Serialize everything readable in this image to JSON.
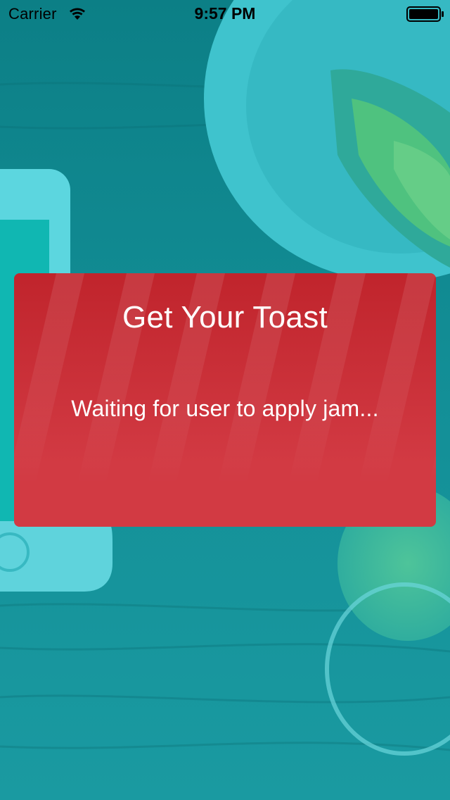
{
  "status_bar": {
    "carrier": "Carrier",
    "time": "9:57 PM",
    "wifi_icon": "wifi-icon",
    "battery_icon": "battery-icon"
  },
  "toast": {
    "title": "Get Your Toast",
    "message": "Waiting for user to apply jam...",
    "color": "#d23a43"
  },
  "colors": {
    "background_tint": "#1aa6ad",
    "toast_red": "#d23a43"
  }
}
